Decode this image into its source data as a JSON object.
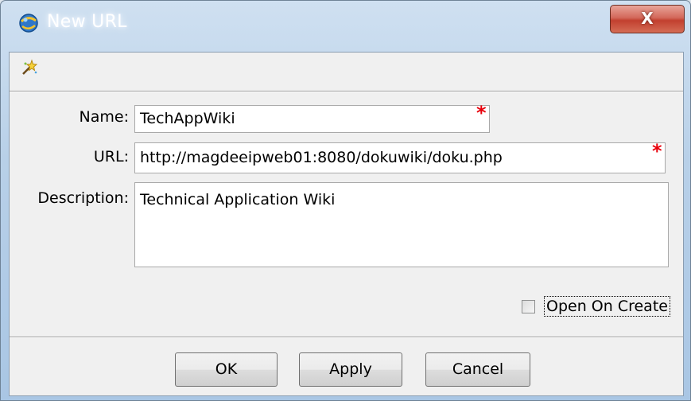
{
  "window": {
    "title": "New URL",
    "close_label": "X"
  },
  "form": {
    "name_label": "Name:",
    "name_value": "TechAppWiki",
    "url_label": "URL:",
    "url_value": "http://magdeeipweb01:8080/dokuwiki/doku.php",
    "description_label": "Description:",
    "description_value": "Technical Application Wiki",
    "required_marker": "*"
  },
  "options": {
    "open_on_create_label": "Open On Create",
    "open_on_create_checked": false
  },
  "buttons": {
    "ok": "OK",
    "apply": "Apply",
    "cancel": "Cancel"
  },
  "icons": {
    "app": "globe-swirl-icon",
    "toolbar": "new-url-wand-icon"
  }
}
